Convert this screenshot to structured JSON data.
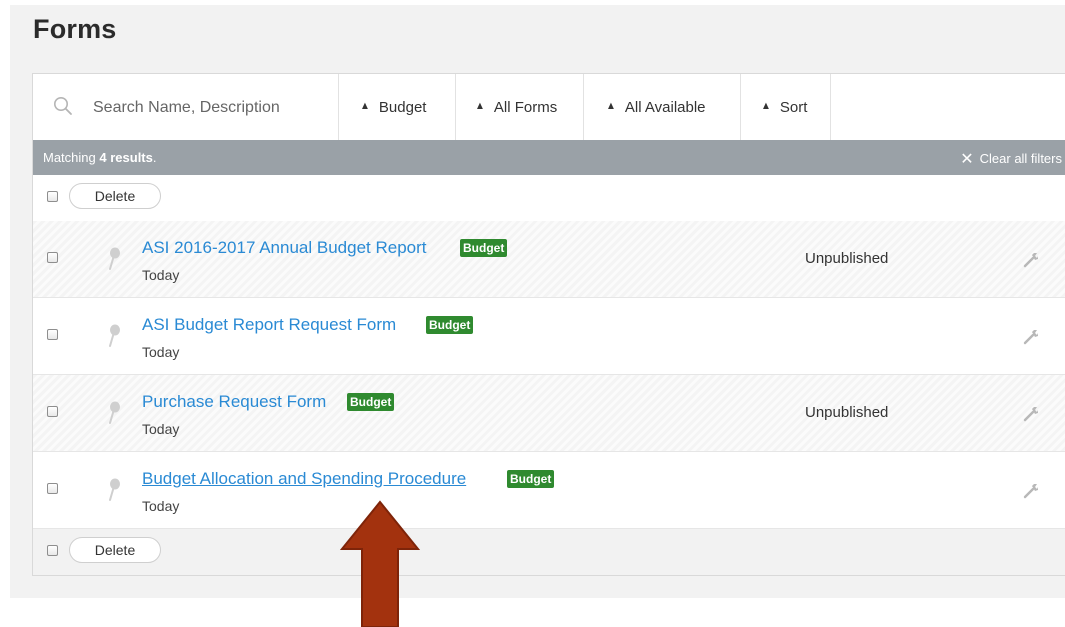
{
  "page": {
    "title": "Forms"
  },
  "search": {
    "placeholder": "Search Name, Description"
  },
  "filters": [
    {
      "label": "Budget"
    },
    {
      "label": "All Forms"
    },
    {
      "label": "All Available"
    },
    {
      "label": "Sort"
    }
  ],
  "results": {
    "prefix": "Matching",
    "count": "4",
    "suffix": "results",
    "period": ".",
    "clear_label": "Clear all filters"
  },
  "actions": {
    "delete_label": "Delete"
  },
  "forms": [
    {
      "title": "ASI 2016-2017 Annual Budget Report",
      "badge": "Budget",
      "date": "Today",
      "status": "Unpublished"
    },
    {
      "title": "ASI Budget Report Request Form",
      "badge": "Budget",
      "date": "Today",
      "status": ""
    },
    {
      "title": "Purchase Request Form",
      "badge": "Budget",
      "date": "Today",
      "status": "Unpublished"
    },
    {
      "title": "Budget Allocation and Spending Procedure",
      "badge": "Budget",
      "date": "Today",
      "status": ""
    }
  ],
  "colors": {
    "link": "#2a8ad4",
    "badge": "#2f8a2f",
    "results_bar": "#9aa1a7",
    "arrow": "#a3320e"
  },
  "icons": {
    "search": "search-icon",
    "pin": "pin-icon",
    "wrench": "wrench-icon",
    "sort": "sort-caret-icon",
    "close": "close-icon"
  }
}
